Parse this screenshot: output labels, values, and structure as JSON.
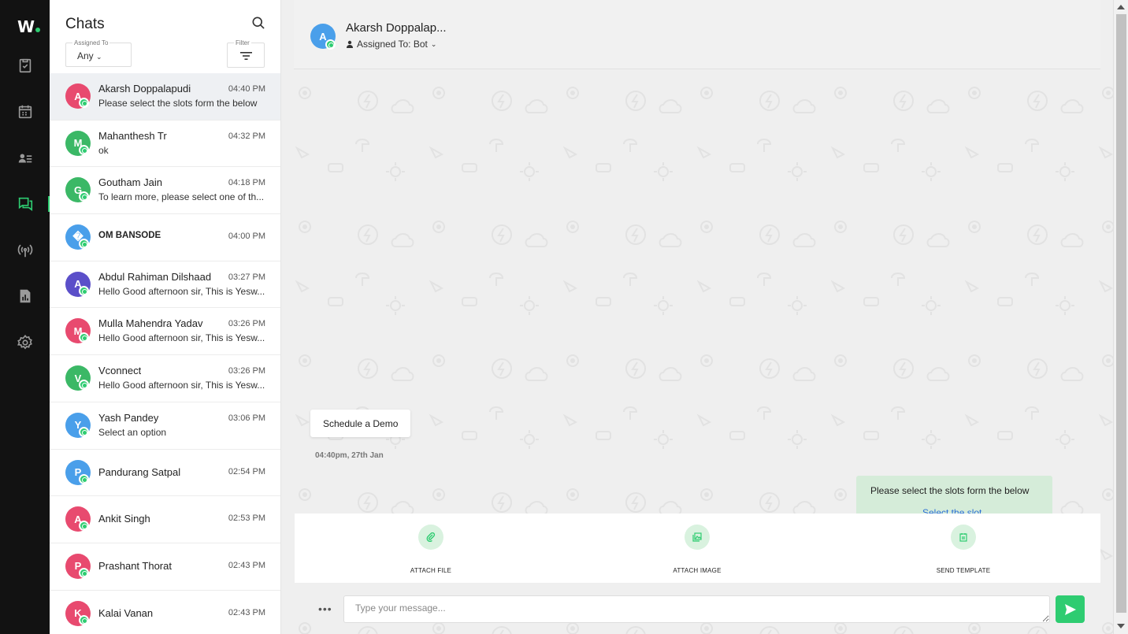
{
  "app": {
    "logo": "W"
  },
  "rail": {
    "items": [
      {
        "icon": "clipboard-check-icon"
      },
      {
        "icon": "calendar-icon"
      },
      {
        "icon": "contacts-icon"
      },
      {
        "icon": "chats-icon",
        "active": true
      },
      {
        "icon": "broadcast-icon"
      },
      {
        "icon": "reports-icon"
      },
      {
        "icon": "gear-icon"
      }
    ]
  },
  "chat_panel": {
    "title": "Chats",
    "assigned_label": "Assigned To",
    "assigned_value": "Any",
    "filter_label": "Filter",
    "chats": [
      {
        "initial": "A",
        "color": "#e84a6f",
        "name": "Akarsh Doppalapudi",
        "time": "04:40 PM",
        "preview": "Please select the slots form the below",
        "active": true
      },
      {
        "initial": "M",
        "color": "#3bb866",
        "name": "Mahanthesh Tr",
        "time": "04:32 PM",
        "preview": "ok"
      },
      {
        "initial": "G",
        "color": "#3bb866",
        "name": "Goutham Jain",
        "time": "04:18 PM",
        "preview": "To learn more, please select one of th..."
      },
      {
        "initial": "�",
        "color": "#4a9fea",
        "name": "OM BANSODE",
        "time": "04:00 PM",
        "preview": ""
      },
      {
        "initial": "A",
        "color": "#5b4fc9",
        "name": "Abdul Rahiman Dilshaad",
        "time": "03:27 PM",
        "preview": "Hello Good afternoon sir, This is Yesw..."
      },
      {
        "initial": "M",
        "color": "#e84a6f",
        "name": "Mulla Mahendra Yadav",
        "time": "03:26 PM",
        "preview": "Hello Good afternoon sir, This is Yesw..."
      },
      {
        "initial": "V",
        "color": "#3bb866",
        "name": "Vconnect",
        "time": "03:26 PM",
        "preview": "Hello Good afternoon sir, This is Yesw..."
      },
      {
        "initial": "Y",
        "color": "#4a9fea",
        "name": "Yash Pandey",
        "time": "03:06 PM",
        "preview": "Select an option"
      },
      {
        "initial": "P",
        "color": "#4a9fea",
        "name": "Pandurang Satpal",
        "time": "02:54 PM",
        "preview": ""
      },
      {
        "initial": "A",
        "color": "#e84a6f",
        "name": "Ankit Singh",
        "time": "02:53 PM",
        "preview": ""
      },
      {
        "initial": "P",
        "color": "#e84a6f",
        "name": "Prashant Thorat",
        "time": "02:43 PM",
        "preview": ""
      },
      {
        "initial": "K",
        "color": "#e84a6f",
        "name": "Kalai Vanan",
        "time": "02:43 PM",
        "preview": ""
      }
    ]
  },
  "conversation": {
    "contact_initial": "A",
    "contact_name": "Akarsh Doppalap...",
    "assigned_to": "Assigned To: Bot",
    "incoming_message": "Schedule a Demo",
    "incoming_time": "04:40pm, 27th Jan",
    "outgoing_message": "Please select the slots form the below",
    "outgoing_link": "Select the slot",
    "attach_options": [
      {
        "icon": "paperclip-icon",
        "label": "ATTACH FILE"
      },
      {
        "icon": "image-icon",
        "label": "ATTACH IMAGE"
      },
      {
        "icon": "template-icon",
        "label": "SEND TEMPLATE"
      }
    ],
    "more_label": "•••",
    "input_placeholder": "Type your message..."
  },
  "colors": {
    "accent": "#2ecc71",
    "rail_bg": "#121212"
  }
}
